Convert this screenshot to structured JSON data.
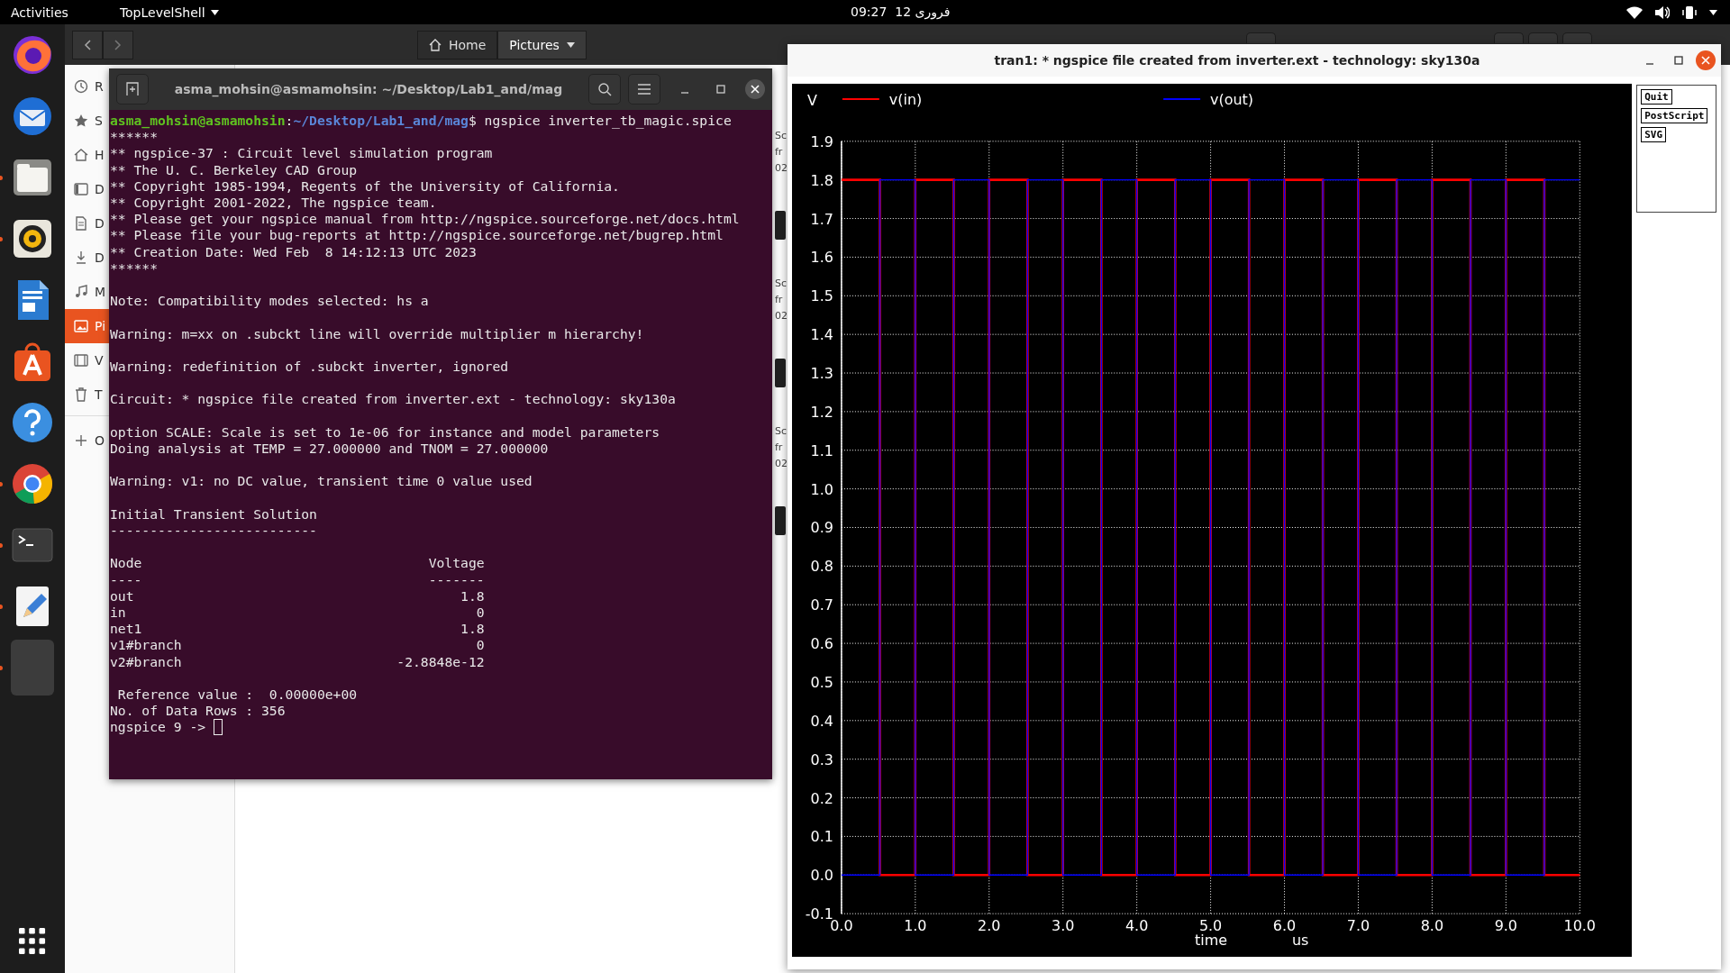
{
  "top_bar": {
    "activities": "Activities",
    "app_menu": "TopLevelShell",
    "time": "09:27",
    "date": "12 فروری"
  },
  "dock": {
    "apps": [
      {
        "kind": "firefox",
        "running": false
      },
      {
        "kind": "mail",
        "running": false
      },
      {
        "kind": "files",
        "running": true
      },
      {
        "kind": "music",
        "running": true
      },
      {
        "kind": "writer",
        "running": false
      },
      {
        "kind": "software",
        "running": false
      },
      {
        "kind": "help",
        "running": false
      },
      {
        "kind": "chrome",
        "running": true
      },
      {
        "kind": "terminal",
        "running": true
      },
      {
        "kind": "editor",
        "running": true
      },
      {
        "kind": "blank",
        "running": true
      }
    ]
  },
  "file_manager": {
    "path": [
      {
        "kind": "home",
        "label": "Home",
        "selected": false
      },
      {
        "kind": "folder",
        "label": "Pictures",
        "selected": true
      }
    ],
    "sidebar": [
      {
        "kind": "recent",
        "label": "R",
        "selected": false
      },
      {
        "kind": "starred",
        "label": "S",
        "selected": false
      },
      {
        "kind": "home",
        "label": "H",
        "selected": false
      },
      {
        "kind": "desktop",
        "label": "D",
        "selected": false
      },
      {
        "kind": "documents",
        "label": "D",
        "selected": false
      },
      {
        "kind": "downloads",
        "label": "D",
        "selected": false
      },
      {
        "kind": "music",
        "label": "M",
        "selected": false
      },
      {
        "kind": "pictures",
        "label": "Pi",
        "selected": true
      },
      {
        "kind": "videos",
        "label": "V",
        "selected": false
      },
      {
        "kind": "trash",
        "label": "T",
        "selected": false
      },
      {
        "kind": "other",
        "label": "O",
        "selected": false
      }
    ],
    "files": [
      {
        "lines": [
          "Sc",
          "fr",
          "02"
        ]
      },
      {
        "lines": [
          "Sc",
          "fr",
          "02"
        ]
      },
      {
        "lines": [
          "Sc",
          "fr",
          "02"
        ]
      }
    ]
  },
  "terminal": {
    "title": "asma_mohsin@asmamohsin: ~/Desktop/Lab1_and/mag",
    "prompt": {
      "user": "asma_mohsin@asmamohsin",
      "sep": ":",
      "path": "~/Desktop/Lab1_and/mag",
      "command": "$ ngspice inverter_tb_magic.spice"
    },
    "blocks": [
      {
        "kind": "text",
        "lines": [
          "******",
          "** ngspice-37 : Circuit level simulation program",
          "** The U. C. Berkeley CAD Group",
          "** Copyright 1985-1994, Regents of the University of California.",
          "** Copyright 2001-2022, The ngspice team.",
          "** Please get your ngspice manual from http://ngspice.sourceforge.net/docs.html",
          "** Please file your bug-reports at http://ngspice.sourceforge.net/bugrep.html",
          "** Creation Date: Wed Feb  8 14:12:13 UTC 2023",
          "******"
        ]
      },
      {
        "kind": "text",
        "lines": [
          "Note: Compatibility modes selected: hs a"
        ]
      },
      {
        "kind": "text",
        "lines": [
          "Warning: m=xx on .subckt line will override multiplier m hierarchy!"
        ]
      },
      {
        "kind": "text",
        "lines": [
          "Warning: redefinition of .subckt inverter, ignored"
        ]
      },
      {
        "kind": "text",
        "lines": [
          "Circuit: * ngspice file created from inverter.ext - technology: sky130a"
        ]
      },
      {
        "kind": "text",
        "lines": [
          "option SCALE: Scale is set to 1e-06 for instance and model parameters",
          "Doing analysis at TEMP = 27.000000 and TNOM = 27.000000"
        ]
      },
      {
        "kind": "text",
        "lines": [
          "Warning: v1: no DC value, transient time 0 value used"
        ]
      },
      {
        "kind": "text",
        "lines": [
          "Initial Transient Solution",
          "--------------------------"
        ]
      },
      {
        "kind": "table",
        "columns": [
          "Node",
          "Voltage"
        ],
        "rules": [
          "----",
          "-------"
        ],
        "rows": [
          {
            "node": "out",
            "voltage": "1.8"
          },
          {
            "node": "in",
            "voltage": "0"
          },
          {
            "node": "net1",
            "voltage": "1.8"
          },
          {
            "node": "v1#branch",
            "voltage": "0"
          },
          {
            "node": "v2#branch",
            "voltage": "-2.8848e-12"
          }
        ]
      },
      {
        "kind": "text",
        "lines": [
          " Reference value :  0.00000e+00",
          "No. of Data Rows : 356"
        ]
      }
    ],
    "input_prompt": "ngspice 9 -> "
  },
  "plot_window": {
    "title": "tran1: * ngspice file created from inverter.ext - technology: sky130a",
    "buttons": [
      "Quit",
      "PostScript",
      "SVG"
    ],
    "x_unit": "us",
    "chart_data": {
      "type": "line",
      "xlabel": "time",
      "ylabel": "V",
      "grid": true,
      "legend": true,
      "x": [
        0,
        0.52,
        0.52,
        1,
        1,
        1.52,
        1.52,
        2,
        2,
        2.52,
        2.52,
        3,
        3,
        3.52,
        3.52,
        4,
        4,
        4.52,
        4.52,
        5,
        5,
        5.52,
        5.52,
        6,
        6,
        6.52,
        6.52,
        7,
        7,
        7.52,
        7.52,
        8,
        8,
        8.52,
        8.52,
        9,
        9,
        9.52,
        9.52,
        10
      ],
      "series": [
        {
          "name": "v(in)",
          "color": "#ff0000",
          "values": [
            1.8,
            1.8,
            0,
            0,
            1.8,
            1.8,
            0,
            0,
            1.8,
            1.8,
            0,
            0,
            1.8,
            1.8,
            0,
            0,
            1.8,
            1.8,
            0,
            0,
            1.8,
            1.8,
            0,
            0,
            1.8,
            1.8,
            0,
            0,
            1.8,
            1.8,
            0,
            0,
            1.8,
            1.8,
            0,
            0,
            1.8,
            1.8,
            0,
            0
          ]
        },
        {
          "name": "v(out)",
          "color": "#0000ff",
          "values": [
            0,
            0,
            1.8,
            1.8,
            0,
            0,
            1.8,
            1.8,
            0,
            0,
            1.8,
            1.8,
            0,
            0,
            1.8,
            1.8,
            0,
            0,
            1.8,
            1.8,
            0,
            0,
            1.8,
            1.8,
            0,
            0,
            1.8,
            1.8,
            0,
            0,
            1.8,
            1.8,
            0,
            0,
            1.8,
            1.8,
            0,
            0,
            1.8,
            1.8
          ]
        }
      ],
      "xlim": [
        0,
        10
      ],
      "ylim": [
        -0.1,
        1.9
      ],
      "xticks": [
        {
          "value": 0,
          "label": "0.0"
        },
        {
          "value": 1,
          "label": "1.0"
        },
        {
          "value": 2,
          "label": "2.0"
        },
        {
          "value": 3,
          "label": "3.0"
        },
        {
          "value": 4,
          "label": "4.0"
        },
        {
          "value": 5,
          "label": "5.0"
        },
        {
          "value": 6,
          "label": "6.0"
        },
        {
          "value": 7,
          "label": "7.0"
        },
        {
          "value": 8,
          "label": "8.0"
        },
        {
          "value": 9,
          "label": "9.0"
        },
        {
          "value": 10,
          "label": "10.0"
        }
      ],
      "yticks": [
        {
          "value": 1.9,
          "label": "1.9"
        },
        {
          "value": 1.8,
          "label": "1.8"
        },
        {
          "value": 1.7,
          "label": "1.7"
        },
        {
          "value": 1.6,
          "label": "1.6"
        },
        {
          "value": 1.5,
          "label": "1.5"
        },
        {
          "value": 1.4,
          "label": "1.4"
        },
        {
          "value": 1.3,
          "label": "1.3"
        },
        {
          "value": 1.2,
          "label": "1.2"
        },
        {
          "value": 1.1,
          "label": "1.1"
        },
        {
          "value": 1.0,
          "label": "1.0"
        },
        {
          "value": 0.9,
          "label": "0.9"
        },
        {
          "value": 0.8,
          "label": "0.8"
        },
        {
          "value": 0.7,
          "label": "0.7"
        },
        {
          "value": 0.6,
          "label": "0.6"
        },
        {
          "value": 0.5,
          "label": "0.5"
        },
        {
          "value": 0.4,
          "label": "0.4"
        },
        {
          "value": 0.3,
          "label": "0.3"
        },
        {
          "value": 0.2,
          "label": "0.2"
        },
        {
          "value": 0.1,
          "label": "0.1"
        },
        {
          "value": 0.0,
          "label": "0.0"
        },
        {
          "value": -0.1,
          "label": "-0.1"
        }
      ]
    }
  }
}
